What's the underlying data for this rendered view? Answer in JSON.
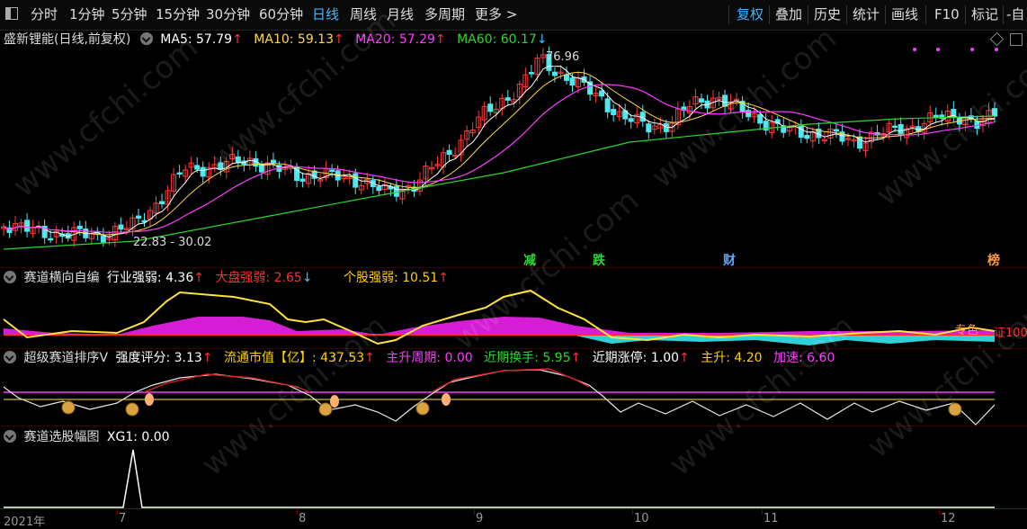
{
  "toolbar": {
    "window_icon": "window-icon",
    "periods": [
      "分时",
      "1分钟",
      "5分钟",
      "15分钟",
      "30分钟",
      "60分钟",
      "日线",
      "周线",
      "月线",
      "多周期",
      "更多 >"
    ],
    "active_period": "日线",
    "actions": [
      "复权",
      "叠加",
      "历史",
      "统计",
      "画线",
      "F10",
      "标记",
      "-自"
    ],
    "active_action": "复权"
  },
  "main_panel": {
    "title": "盛新锂能(日线,前复权)",
    "ma": [
      {
        "label": "MA5: 57.79",
        "arrow": "↑",
        "color": "#ffffff"
      },
      {
        "label": "MA10: 59.13",
        "arrow": "↑",
        "color": "#ffd84a"
      },
      {
        "label": "MA20: 57.29",
        "arrow": "↑",
        "color": "#ff3bff"
      },
      {
        "label": "MA60: 60.17",
        "arrow": "↓",
        "color": "#2bd62b"
      }
    ],
    "high_label": "76.96",
    "low_label": "22.83 - 30.02",
    "signals": [
      {
        "text": "减",
        "color": "#35d23b"
      },
      {
        "text": "跌",
        "color": "#35d23b"
      },
      {
        "text": "财",
        "color": "#5aa8ff"
      },
      {
        "text": "榜",
        "color": "#ff9b3d"
      }
    ]
  },
  "panel2": {
    "title": "赛道横向自编",
    "fields": [
      {
        "label": "行业强弱: 4.36",
        "arrow": "↑",
        "color": "#ffffff"
      },
      {
        "label": "大盘强弱: 2.65",
        "arrow": "↓",
        "color": "#ff3030"
      },
      {
        "label": "个股强弱: 10.51",
        "arrow": "↑",
        "color": "#ffd000"
      }
    ],
    "tags": [
      "专色",
      "证100"
    ]
  },
  "panel3": {
    "title": "超级赛道排序V",
    "fields": [
      {
        "label": "强度评分: 3.13",
        "arrow": "↑",
        "color": "#ffffff"
      },
      {
        "label": "流通市值【亿】: 437.53",
        "arrow": "↑",
        "color": "#ffd000"
      },
      {
        "label": "主升周期: 0.00",
        "arrow": "",
        "color": "#ff3bff"
      },
      {
        "label": "近期换手: 5.95",
        "arrow": "↑",
        "color": "#2bd62b"
      },
      {
        "label": "近期涨停: 1.00",
        "arrow": "↑",
        "color": "#ffffff"
      },
      {
        "label": "主升: 4.20",
        "arrow": "",
        "color": "#ffd000"
      },
      {
        "label": "加速: 6.60",
        "arrow": "",
        "color": "#ff3bff"
      }
    ]
  },
  "panel4": {
    "title": "赛道选股幅图",
    "fields": [
      {
        "label": "XG1: 0.00",
        "arrow": "",
        "color": "#ffffff"
      }
    ]
  },
  "time_axis": [
    "2021年",
    "7",
    "8",
    "9",
    "10",
    "11",
    "12"
  ],
  "watermark": "www.cfchi.com"
}
